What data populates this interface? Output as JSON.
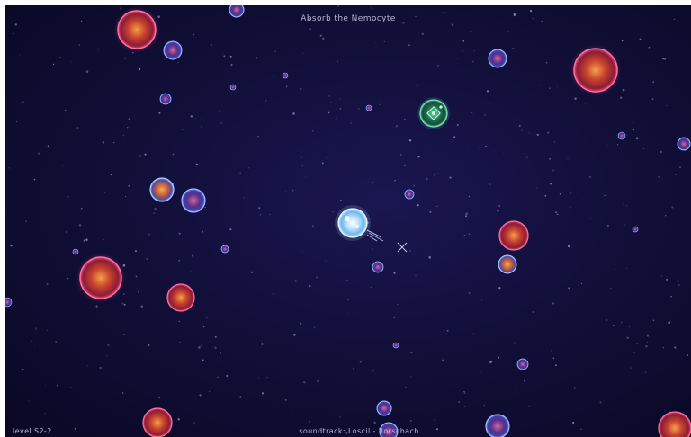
{
  "hud": {
    "objective": "Absorb the Nemocyte",
    "level": "level S2-2",
    "soundtrack": "soundtrack: Loscil - Rorschach"
  },
  "colors": {
    "background": "#120f3a",
    "player_mote": "#9fd4ff",
    "hostile_mote": "#e0463c",
    "neutral_mote": "#6a5fd0",
    "nemocyte": "#2f8f6a",
    "hud_text": "#b8b6d6"
  },
  "entities": {
    "player": "player-mote",
    "target": "nemocyte",
    "hostile": "red-mote",
    "neutral": "blue-mote"
  }
}
